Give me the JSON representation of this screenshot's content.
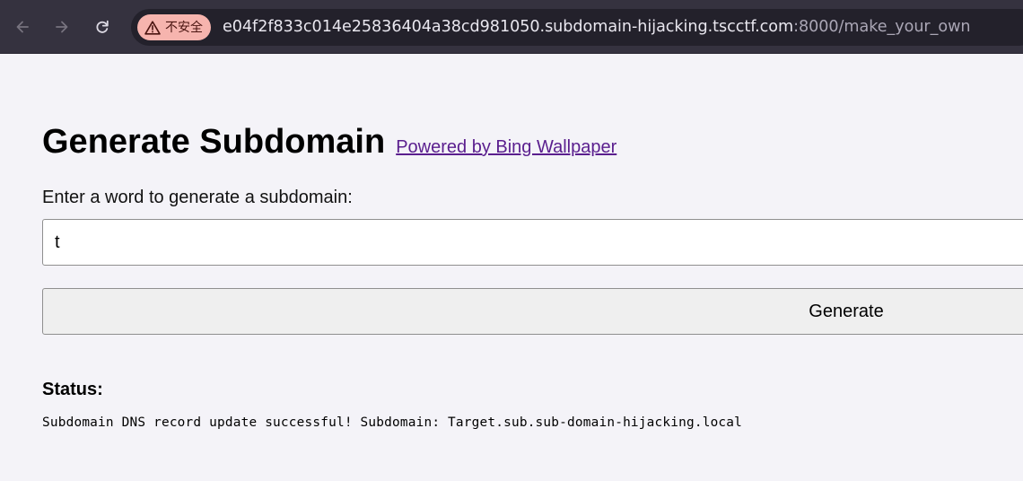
{
  "browser": {
    "security_chip_label": "不安全",
    "url_host": "e04f2f833c014e25836404a38cd981050.subdomain-hijacking.tscctf.com",
    "url_path": ":8000/make_your_own",
    "icons": {
      "back": "arrow-left-icon",
      "forward": "arrow-right-icon",
      "reload": "reload-icon",
      "security": "warning-triangle-icon"
    },
    "colors": {
      "toolbar": "#35323f",
      "omnibox": "#23212b",
      "security_chip": "#f6b4ae"
    }
  },
  "page": {
    "title": "Generate Subdomain",
    "powered_link": "Powered by Bing Wallpaper",
    "prompt_label": "Enter a word to generate a subdomain:",
    "input_value": "t",
    "generate_label": "Generate",
    "status_heading": "Status:",
    "status_message": "Subdomain DNS record update successful! Subdomain: Target.sub.sub-domain-hijacking.local",
    "colors": {
      "background": "#f4f3f8",
      "link": "#5a1e8e"
    }
  }
}
